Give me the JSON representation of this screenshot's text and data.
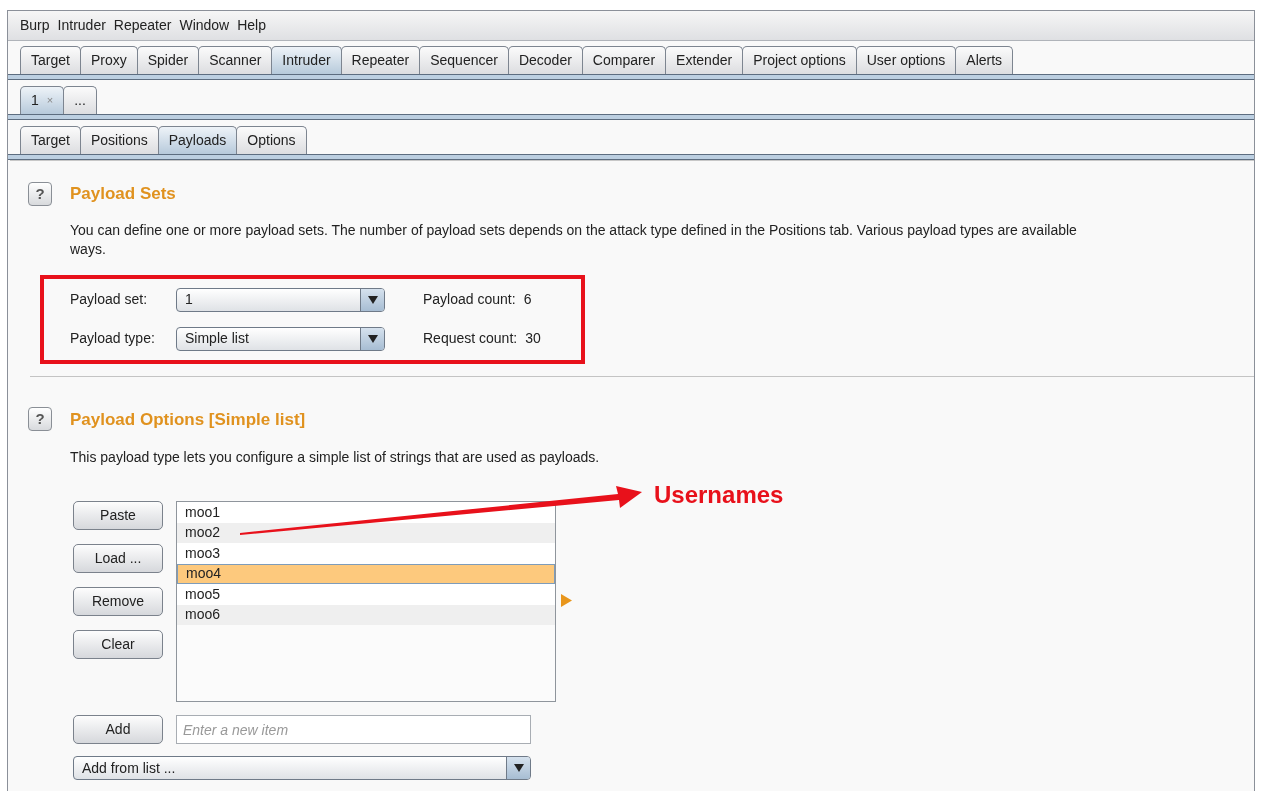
{
  "menu_bar": [
    "Burp",
    "Intruder",
    "Repeater",
    "Window",
    "Help"
  ],
  "main_tabs": [
    {
      "label": "Target",
      "selected": false
    },
    {
      "label": "Proxy",
      "selected": false
    },
    {
      "label": "Spider",
      "selected": false
    },
    {
      "label": "Scanner",
      "selected": false
    },
    {
      "label": "Intruder",
      "selected": true
    },
    {
      "label": "Repeater",
      "selected": false
    },
    {
      "label": "Sequencer",
      "selected": false
    },
    {
      "label": "Decoder",
      "selected": false
    },
    {
      "label": "Comparer",
      "selected": false
    },
    {
      "label": "Extender",
      "selected": false
    },
    {
      "label": "Project options",
      "selected": false
    },
    {
      "label": "User options",
      "selected": false
    },
    {
      "label": "Alerts",
      "selected": false
    }
  ],
  "instance_tabs": [
    {
      "label": "1",
      "close": "×",
      "selected": true
    },
    {
      "label": "...",
      "selected": false
    }
  ],
  "intruder_tabs": [
    {
      "label": "Target",
      "selected": false
    },
    {
      "label": "Positions",
      "selected": false
    },
    {
      "label": "Payloads",
      "selected": true
    },
    {
      "label": "Options",
      "selected": false
    }
  ],
  "payload_sets": {
    "help": "?",
    "title": "Payload Sets",
    "description": [
      "You can define one or more payload sets. The number of payload sets depends on the attack type defined in the Positions tab. Various payload types are available",
      "ways."
    ],
    "fields": [
      {
        "label": "Payload set:",
        "value": "1",
        "count_label": "Payload count:",
        "count": "6"
      },
      {
        "label": "Payload type:",
        "value": "Simple list",
        "count_label": "Request count:",
        "count": "30"
      }
    ]
  },
  "payload_options": {
    "help": "?",
    "title": "Payload Options [Simple list]",
    "description": "This payload type lets you configure a simple list of strings that are used as payloads.",
    "buttons": [
      "Paste",
      "Load ...",
      "Remove",
      "Clear"
    ],
    "items": [
      {
        "text": "moo1",
        "selected": false
      },
      {
        "text": "moo2",
        "selected": false
      },
      {
        "text": "moo3",
        "selected": false
      },
      {
        "text": "moo4",
        "selected": true
      },
      {
        "text": "moo5",
        "selected": false
      },
      {
        "text": "moo6",
        "selected": false
      }
    ],
    "add_button": "Add",
    "add_placeholder": "Enter a new item",
    "add_from_list": "Add from list ..."
  },
  "annotation": {
    "label": "Usernames"
  }
}
